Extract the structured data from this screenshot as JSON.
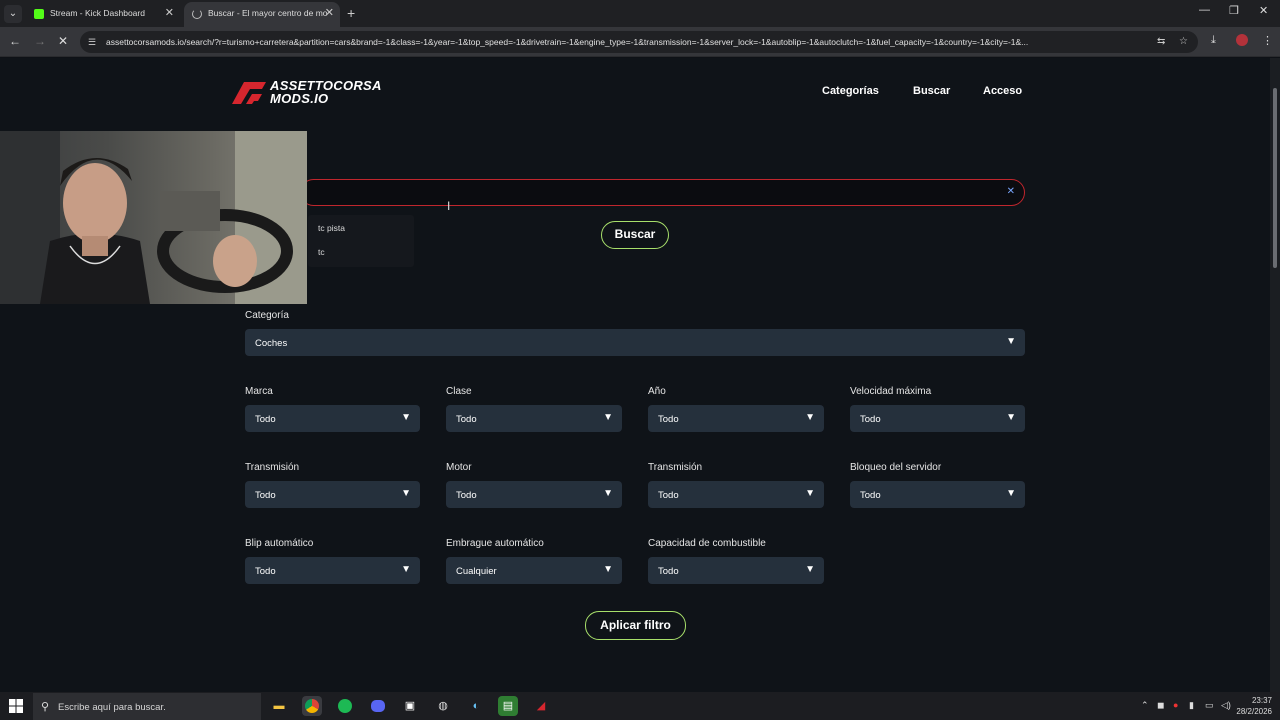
{
  "browser": {
    "tabs": [
      {
        "title": "Stream - Kick Dashboard",
        "icon": "kick-icon"
      },
      {
        "title": "Buscar - El mayor centro de mo",
        "icon": "loading-icon"
      }
    ],
    "url": "assettocorsamods.io/search/?r=turismo+carretera&partition=cars&brand=-1&class=-1&year=-1&top_speed=-1&drivetrain=-1&engine_type=-1&transmission=-1&server_lock=-1&autoblip=-1&autoclutch=-1&fuel_capacity=-1&country=-1&city=-1&..."
  },
  "site": {
    "logo_line1": "ASSETTOCORSA",
    "logo_line2": "MODS.IO",
    "nav": [
      "Categorías",
      "Buscar",
      "Acceso"
    ],
    "brand_color": "#d6262e",
    "accent_color": "#a8e06b"
  },
  "search": {
    "value": "",
    "suggestions": [
      "tc pista",
      "tc"
    ],
    "button": "Buscar"
  },
  "filters": {
    "category": {
      "label": "Categoría",
      "value": "Coches"
    },
    "rows": [
      [
        {
          "label": "Marca",
          "value": "Todo"
        },
        {
          "label": "Clase",
          "value": "Todo"
        },
        {
          "label": "Año",
          "value": "Todo"
        },
        {
          "label": "Velocidad máxima",
          "value": "Todo"
        }
      ],
      [
        {
          "label": "Transmisión",
          "value": "Todo"
        },
        {
          "label": "Motor",
          "value": "Todo"
        },
        {
          "label": "Transmisión",
          "value": "Todo"
        },
        {
          "label": "Bloqueo del servidor",
          "value": "Todo"
        }
      ],
      [
        {
          "label": "Blip automático",
          "value": "Todo"
        },
        {
          "label": "Embrague automático",
          "value": "Cualquier"
        },
        {
          "label": "Capacidad de combustible",
          "value": "Todo"
        }
      ]
    ],
    "apply_button": "Aplicar filtro"
  },
  "taskbar": {
    "search_placeholder": "Escribe aquí para buscar.",
    "time": "23:37",
    "date": "28/2/2026"
  }
}
